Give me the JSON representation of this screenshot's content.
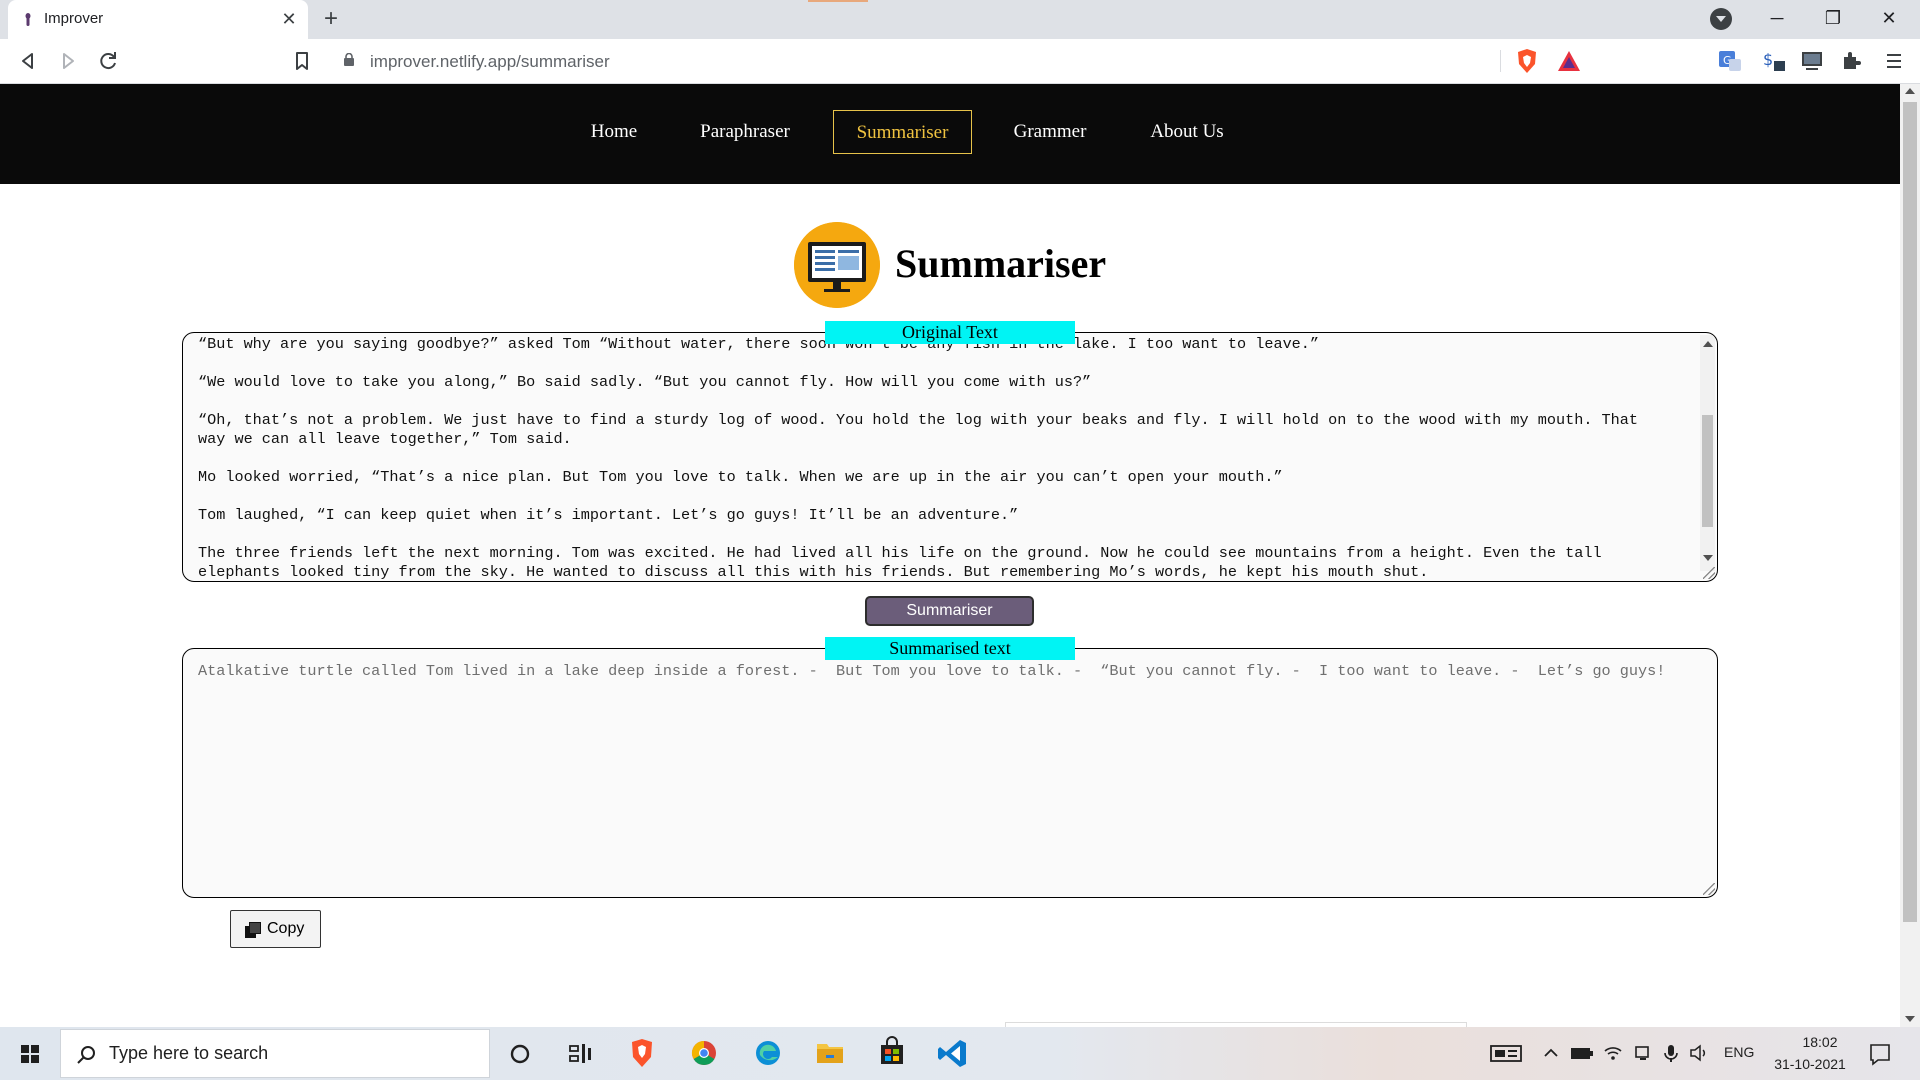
{
  "browser": {
    "tab_title": "Improver",
    "tab_close": "✕",
    "new_tab": "+",
    "url": "improver.netlify.app/summariser",
    "window_minimize": "─",
    "window_restore": "❐",
    "window_close": "✕"
  },
  "site_nav": {
    "items": [
      {
        "label": "Home",
        "active": false
      },
      {
        "label": "Paraphraser",
        "active": false
      },
      {
        "label": "Summariser",
        "active": true
      },
      {
        "label": "Grammer",
        "active": false
      },
      {
        "label": "About Us",
        "active": false
      }
    ],
    "active_color": "#f0c340"
  },
  "page": {
    "title": "Summariser",
    "original_label": "Original Text",
    "original_text": "“But why are you saying goodbye?” asked Tom “Without water, there soon won’t be any fish in the lake. I too want to leave.”\n\n“We would love to take you along,” Bo said sadly. “But you cannot fly. How will you come with us?”\n\n“Oh, that’s not a problem. We just have to find a sturdy log of wood. You hold the log with your beaks and fly. I will hold on to the wood with my mouth. That\nway we can all leave together,” Tom said.\n\nMo looked worried, “That’s a nice plan. But Tom you love to talk. When we are up in the air you can’t open your mouth.”\n\nTom laughed, “I can keep quiet when it’s important. Let’s go guys! It’ll be an adventure.”\n\nThe three friends left the next morning. Tom was excited. He had lived all his life on the ground. Now he could see mountains from a height. Even the tall\nelephants looked tiny from the sky. He wanted to discuss all this with his friends. But remembering Mo’s words, he kept his mouth shut.",
    "summarise_button": "Summariser",
    "summary_label": "Summarised text",
    "summary_text": "Atalkative turtle called Tom lived in a lake deep inside a forest. -  But Tom you love to talk. -  “But you cannot fly. -  I too want to leave. -  Let’s go guys!",
    "copy_button": "Copy",
    "label_bg": "#00f4f4",
    "button_bg": "#6b5d7a"
  },
  "taskbar": {
    "search_placeholder": "Type here to search",
    "language": "ENG",
    "time": "18:02",
    "date": "31-10-2021"
  }
}
